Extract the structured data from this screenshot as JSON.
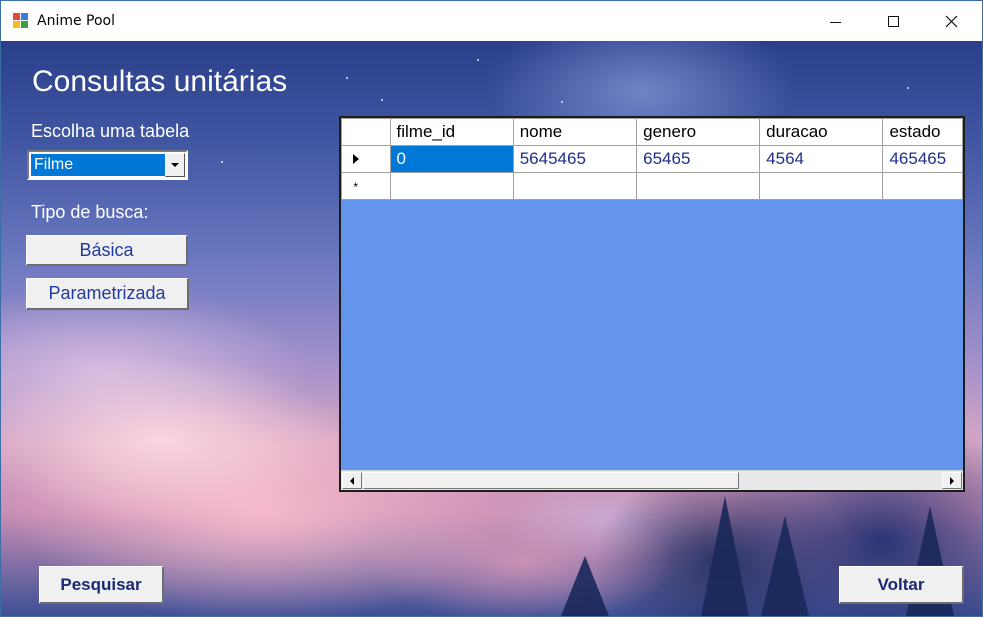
{
  "window": {
    "title": "Anime Pool",
    "accent_color": "#0078d7"
  },
  "main": {
    "heading": "Consultas unitárias",
    "choose_table_label": "Escolha uma tabela",
    "table_select": {
      "selected": "Filme"
    },
    "search_type_label": "Tipo de busca:",
    "basic_button": "Básica",
    "parametrized_button": "Parametrizada",
    "search_button": "Pesquisar",
    "back_button": "Voltar"
  },
  "grid": {
    "columns": [
      "filme_id",
      "nome",
      "genero",
      "duracao",
      "estado"
    ],
    "rows": [
      [
        "0",
        "5645465",
        "65465",
        "4564",
        "465465"
      ]
    ],
    "background_color": "#6495ed"
  },
  "icons": {
    "current_row": "row-pointer-icon",
    "new_row": "new-row-asterisk-icon"
  }
}
